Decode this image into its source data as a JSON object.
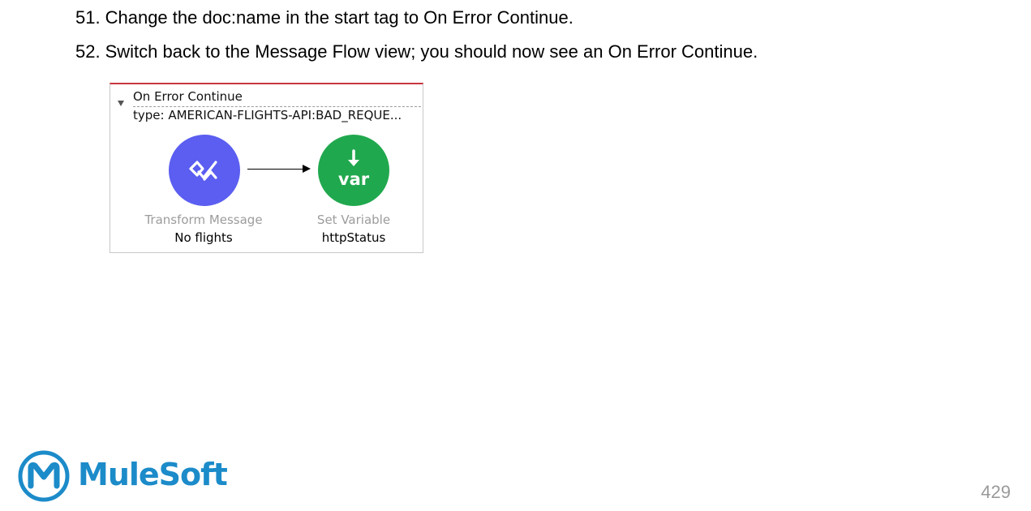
{
  "steps": [
    {
      "number": "51.",
      "text": "Change the doc:name in the start tag to On Error Continue."
    },
    {
      "number": "52.",
      "text": "Switch back to the Message Flow view; you should now see an On Error Continue."
    }
  ],
  "flow_panel": {
    "title": "On Error Continue",
    "type_line": "type: AMERICAN-FLIGHTS-API:BAD_REQUE...",
    "accent_color": "#c9363e",
    "nodes": [
      {
        "type": "Transform Message",
        "name": "No flights",
        "icon": "transform-message-icon",
        "color": "#5b5ef0"
      },
      {
        "type": "Set Variable",
        "name": "httpStatus",
        "icon": "set-variable-icon",
        "glyph": "var",
        "color": "#20a84e"
      }
    ]
  },
  "footer": {
    "brand": "MuleSoft",
    "brand_color": "#1c8bc9",
    "page_number": "429"
  }
}
